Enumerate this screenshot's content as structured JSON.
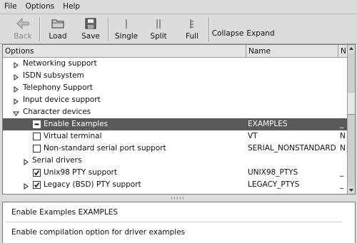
{
  "menu": [
    "File",
    "Options",
    "Help"
  ],
  "toolbar": {
    "back": "Back",
    "load": "Load",
    "save": "Save",
    "single": "Single",
    "split": "Split",
    "full": "Full",
    "collapse": "Collapse",
    "expand": "Expand"
  },
  "columns": {
    "options": "Options",
    "name": "Name",
    "n": "N"
  },
  "tree": [
    {
      "label": "Networking support",
      "name": "",
      "n": "",
      "expander": "collapsed",
      "check": "",
      "selected": false
    },
    {
      "label": "ISDN subsystem",
      "name": "",
      "n": "",
      "expander": "collapsed",
      "check": "",
      "selected": false
    },
    {
      "label": "Telephony Support",
      "name": "",
      "n": "",
      "expander": "collapsed",
      "check": "",
      "selected": false
    },
    {
      "label": "Input device support",
      "name": "",
      "n": "",
      "expander": "collapsed",
      "check": "",
      "selected": false
    },
    {
      "label": "Character devices",
      "name": "",
      "n": "",
      "expander": "expanded",
      "check": "",
      "selected": false
    },
    {
      "label": "Enable Examples",
      "name": "EXAMPLES",
      "n": "_",
      "expander": "",
      "check": "partial",
      "selected": true
    },
    {
      "label": "Virtual terminal",
      "name": "VT",
      "n": "N",
      "expander": "",
      "check": "unchecked",
      "selected": false
    },
    {
      "label": "Non-standard serial port support",
      "name": "SERIAL_NONSTANDARD",
      "n": "N",
      "expander": "",
      "check": "unchecked",
      "selected": false
    },
    {
      "label": "Serial drivers",
      "name": "",
      "n": "",
      "expander": "collapsed",
      "check": "",
      "selected": false
    },
    {
      "label": "Unix98 PTY support",
      "name": "UNIX98_PTYS",
      "n": "_",
      "expander": "",
      "check": "checked",
      "selected": false
    },
    {
      "label": "Legacy (BSD) PTY support",
      "name": "LEGACY_PTYS",
      "n": "_",
      "expander": "collapsed",
      "check": "checked",
      "selected": false
    }
  ],
  "help": {
    "title": "Enable Examples EXAMPLES",
    "text": "Enable compilation option for driver examples"
  },
  "colors": {
    "selection": "#5a5a5a",
    "window": "#dcdcdc"
  }
}
